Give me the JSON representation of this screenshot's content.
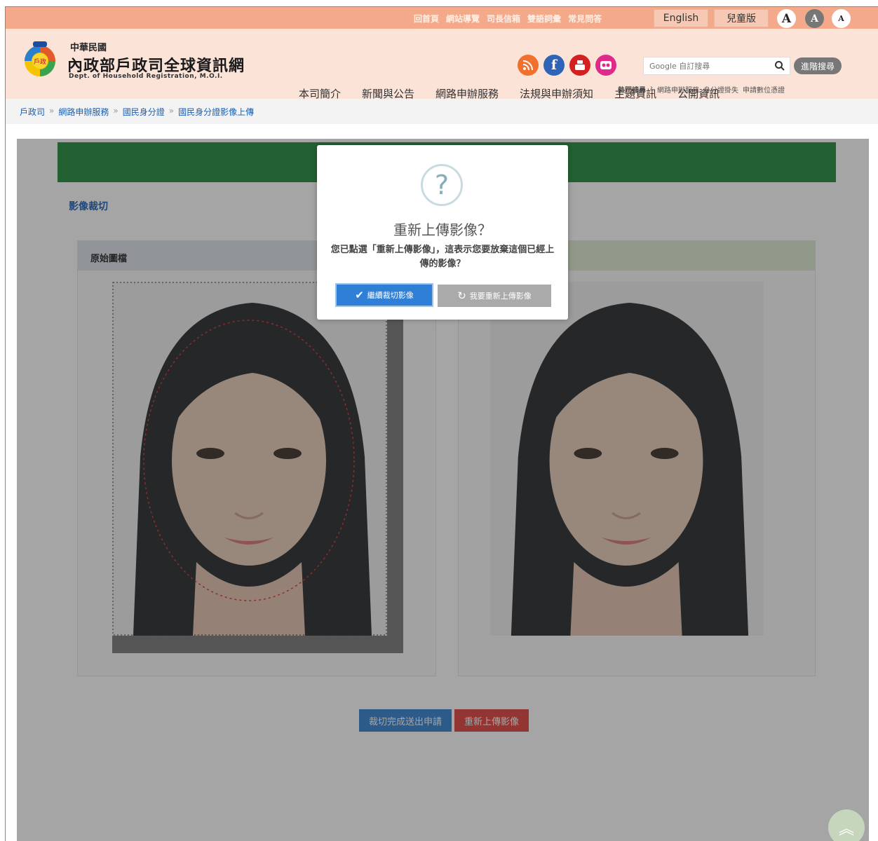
{
  "topbar": {
    "links": [
      "回首頁",
      "網站導覽",
      "司長信箱",
      "雙語詞彙",
      "常見問答"
    ],
    "english": "English",
    "kids": "兒童版",
    "font_large": "A",
    "font_medium": "A",
    "font_small": "A"
  },
  "header": {
    "sub_title": "中華民國",
    "title": "內政部戶政司全球資訊網",
    "en_title": "Dept. of Household Registration, M.O.I.",
    "search_placeholder": "Google 自訂搜尋",
    "advanced_search": "進階搜尋",
    "hot_label": "熱門搜尋",
    "hot_links": [
      "網路申辦服務",
      "身分證掛失",
      "申請數位憑證"
    ],
    "nav": [
      "本司簡介",
      "新聞與公告",
      "網路申辦服務",
      "法規與申辦須知",
      "主題資訊",
      "公開資訊"
    ]
  },
  "breadcrumb": [
    "戶政司",
    "網路申辦服務",
    "國民身分證",
    "國民身分證影像上傳"
  ],
  "content": {
    "section_title": "影像裁切",
    "left_panel_title": "原始圖檔",
    "submit_button": "裁切完成送出申請",
    "reupload_button": "重新上傳影像"
  },
  "modal": {
    "icon": "?",
    "title": "重新上傳影像？",
    "text": "您已點選「重新上傳影像」，這表示您要放棄這個已經上傳的影像？",
    "confirm": "繼續裁切影像",
    "cancel": "我要重新上傳影像"
  },
  "colors": {
    "topbar": "#f4a98a",
    "header": "#fbe3d8",
    "green_bar": "#1f8a3c",
    "primary": "#2f80d0",
    "danger": "#e0403c"
  }
}
